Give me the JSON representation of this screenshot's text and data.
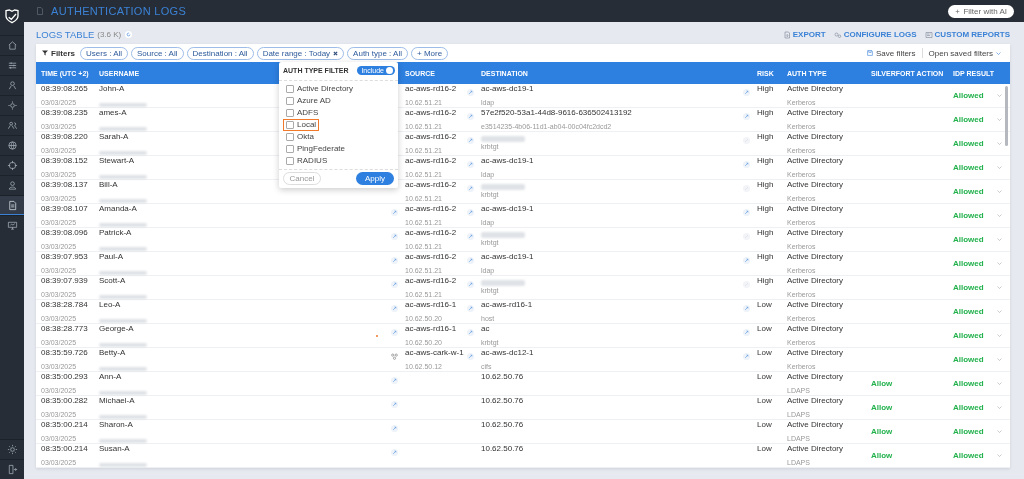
{
  "sidebar": {
    "items": [
      {
        "selected": false
      },
      {
        "selected": false
      },
      {
        "selected": false
      },
      {
        "selected": false
      },
      {
        "selected": false
      },
      {
        "selected": false
      },
      {
        "selected": false
      },
      {
        "selected": false
      },
      {
        "selected": true
      },
      {
        "selected": false
      }
    ],
    "bottom_items": [
      {
        "selected": false
      },
      {
        "selected": false
      }
    ]
  },
  "header": {
    "title": "AUTHENTICATION LOGS",
    "ai_button": "Filter with AI"
  },
  "page": {
    "title": "LOGS TABLE",
    "count": "(3.6 K)",
    "actions": [
      "EXPORT",
      "CONFIGURE LOGS",
      "CUSTOM REPORTS"
    ]
  },
  "filters": {
    "label": "Filters",
    "chips": [
      {
        "label": "Users : All",
        "removable": false
      },
      {
        "label": "Source : All",
        "removable": false
      },
      {
        "label": "Destination : All",
        "removable": false
      },
      {
        "label": "Date range : Today",
        "removable": true
      },
      {
        "label": "Auth type : All",
        "removable": false
      }
    ],
    "more": "+ More",
    "save": "Save filters",
    "open_saved": "Open saved filters"
  },
  "table": {
    "columns": [
      "TIME (UTC +2)",
      "USERNAME",
      "SOURCE",
      "DESTINATION",
      "RISK",
      "AUTH TYPE",
      "SILVERFORT ACTION",
      "IDP RESULT"
    ],
    "rows": [
      {
        "time": "08:39:08.265",
        "date": "03/03/2025",
        "user": "John-A",
        "source": "ac-aws-rd16-2",
        "source_ip": "10.62.51.21",
        "dest_icon": true,
        "destination": "ac-aws-dc19-1",
        "dest_sub": "ldap",
        "risk_icon": {
          "kind": "link"
        },
        "risk": "High",
        "auth": "Active Directory",
        "auth_sub": "Kerberos",
        "idp": "Allowed"
      },
      {
        "time": "08:39:08.235",
        "date": "03/03/2025",
        "user": "ames-A",
        "source": "ac-aws-rd16-2",
        "source_ip": "10.62.51.21",
        "dest_icon": true,
        "destination": "57e2f520-53a1-44d8-9616-636502413192",
        "dest_sub": "e3514235-4b06-11d1-ab04-00c04fc2dcd2",
        "risk_icon": {
          "kind": "link"
        },
        "risk": "High",
        "auth": "Active Directory",
        "auth_sub": "Kerberos",
        "idp": "Allowed"
      },
      {
        "time": "08:39:08.220",
        "date": "03/03/2025",
        "user": "Sarah-A",
        "source": "ac-aws-rd16-2",
        "source_ip": "10.62.51.21",
        "dest_icon": true,
        "dest_sub": "krbtgt",
        "risk_icon": {
          "kind": "faint"
        },
        "risk": "High",
        "auth": "Active Directory",
        "auth_sub": "Kerberos",
        "idp": "Allowed"
      },
      {
        "time": "08:39:08.152",
        "date": "03/03/2025",
        "user": "Stewart-A",
        "source": "ac-aws-rd16-2",
        "source_ip": "10.62.51.21",
        "dest_icon": true,
        "destination": "ac-aws-dc19-1",
        "dest_sub": "ldap",
        "risk_icon": {
          "kind": "link"
        },
        "risk": "High",
        "auth": "Active Directory",
        "auth_sub": "Kerberos",
        "idp": "Allowed"
      },
      {
        "time": "08:39:08.137",
        "date": "03/03/2025",
        "user": "Bill-A",
        "source": "ac-aws-rd16-2",
        "source_ip": "10.62.51.21",
        "dest_icon": true,
        "dest_sub": "krbtgt",
        "risk_icon": {
          "kind": "faint"
        },
        "risk": "High",
        "auth": "Active Directory",
        "auth_sub": "Kerberos",
        "idp": "Allowed"
      },
      {
        "time": "08:39:08.107",
        "date": "03/03/2025",
        "user": "Amanda-A",
        "source_icon": {
          "kind": "link"
        },
        "source": "ac-aws-rd16-2",
        "source_ip": "10.62.51.21",
        "dest_icon": true,
        "destination": "ac-aws-dc19-1",
        "dest_sub": "ldap",
        "risk_icon": {
          "kind": "link"
        },
        "risk": "High",
        "auth": "Active Directory",
        "auth_sub": "Kerberos",
        "idp": "Allowed"
      },
      {
        "time": "08:39:08.096",
        "date": "03/03/2025",
        "user": "Patrick-A",
        "source_icon": {
          "kind": "link"
        },
        "source": "ac-aws-rd16-2",
        "source_ip": "10.62.51.21",
        "dest_icon": true,
        "dest_sub": "krbtgt",
        "risk_icon": {
          "kind": "faint"
        },
        "risk": "High",
        "auth": "Active Directory",
        "auth_sub": "Kerberos",
        "idp": "Allowed"
      },
      {
        "time": "08:39:07.953",
        "date": "03/03/2025",
        "user": "Paul-A",
        "source_icon": {
          "kind": "link"
        },
        "source": "ac-aws-rd16-2",
        "source_ip": "10.62.51.21",
        "dest_icon": true,
        "destination": "ac-aws-dc19-1",
        "dest_sub": "ldap",
        "risk_icon": {
          "kind": "link"
        },
        "risk": "High",
        "auth": "Active Directory",
        "auth_sub": "Kerberos",
        "idp": "Allowed"
      },
      {
        "time": "08:39:07.939",
        "date": "03/03/2025",
        "user": "Scott-A",
        "source_icon": {
          "kind": "link"
        },
        "source": "ac-aws-rd16-2",
        "source_ip": "10.62.51.21",
        "dest_icon": true,
        "dest_sub": "krbtgt",
        "risk_icon": {
          "kind": "faint"
        },
        "risk": "High",
        "auth": "Active Directory",
        "auth_sub": "Kerberos",
        "idp": "Allowed"
      },
      {
        "time": "08:38:28.784",
        "date": "03/03/2025",
        "user": "Leo-A",
        "source_icon": {
          "kind": "link"
        },
        "source": "ac-aws-rd16-1",
        "source_ip": "10.62.50.20",
        "dest_icon": true,
        "destination": "ac-aws-rd16-1",
        "dest_sub": "host",
        "risk_icon": {
          "kind": "link"
        },
        "risk": "Low",
        "auth": "Active Directory",
        "auth_sub": "Kerberos",
        "idp": "Allowed"
      },
      {
        "time": "08:38:28.773",
        "date": "03/03/2025",
        "user": "George-A",
        "marker": true,
        "source_icon": {
          "kind": "link"
        },
        "source": "ac-aws-rd16-1",
        "source_ip": "10.62.50.20",
        "dest_icon": true,
        "destination": "ac",
        "dest_sub": "krbtgt",
        "risk_icon": {
          "kind": "link"
        },
        "risk": "Low",
        "auth": "Active Directory",
        "auth_sub": "Kerberos",
        "idp": "Allowed"
      },
      {
        "time": "08:35:59.726",
        "date": "03/03/2025",
        "user": "Betty-A",
        "source_icon": {
          "kind": "cluster"
        },
        "source": "ac-aws-cark-w-1",
        "source_ip": "10.62.50.12",
        "dest_icon": true,
        "destination": "ac-aws-dc12-1",
        "dest_sub": "cifs",
        "risk_icon": {
          "kind": "link"
        },
        "risk": "Low",
        "auth": "Active Directory",
        "auth_sub": "Kerberos",
        "idp": "Allowed"
      },
      {
        "time": "08:35:00.293",
        "date": "03/03/2025",
        "user": "Ann-A",
        "source_icon": {
          "kind": "link"
        },
        "destination": "10.62.50.76",
        "risk": "Low",
        "auth": "Active Directory",
        "auth_sub": "LDAPS",
        "action": "Allow",
        "idp": "Allowed"
      },
      {
        "time": "08:35:00.282",
        "date": "03/03/2025",
        "user": "Michael-A",
        "source_icon": {
          "kind": "link"
        },
        "destination": "10.62.50.76",
        "risk": "Low",
        "auth": "Active Directory",
        "auth_sub": "LDAPS",
        "action": "Allow",
        "idp": "Allowed"
      },
      {
        "time": "08:35:00.214",
        "date": "03/03/2025",
        "user": "Sharon-A",
        "source_icon": {
          "kind": "link"
        },
        "destination": "10.62.50.76",
        "risk": "Low",
        "auth": "Active Directory",
        "auth_sub": "LDAPS",
        "action": "Allow",
        "idp": "Allowed"
      },
      {
        "time": "08:35:00.214",
        "date": "03/03/2025",
        "user": "Susan-A",
        "source_icon": {
          "kind": "link"
        },
        "destination": "10.62.50.76",
        "risk": "Low",
        "auth": "Active Directory",
        "auth_sub": "LDAPS",
        "action": "Allow",
        "idp": "Allowed"
      }
    ]
  },
  "popup": {
    "title": "AUTH TYPE FILTER",
    "toggle": {
      "label": "Include",
      "on": true
    },
    "options": [
      {
        "label": "Active Directory",
        "checked": false,
        "focused": false
      },
      {
        "label": "Azure AD",
        "checked": false,
        "focused": false
      },
      {
        "label": "ADFS",
        "checked": false,
        "focused": false
      },
      {
        "label": "Local",
        "checked": false,
        "focused": true
      },
      {
        "label": "Okta",
        "checked": false,
        "focused": false
      },
      {
        "label": "PingFederate",
        "checked": false,
        "focused": false
      },
      {
        "label": "RADIUS",
        "checked": false,
        "focused": false
      }
    ],
    "cancel": "Cancel",
    "apply": "Apply"
  }
}
